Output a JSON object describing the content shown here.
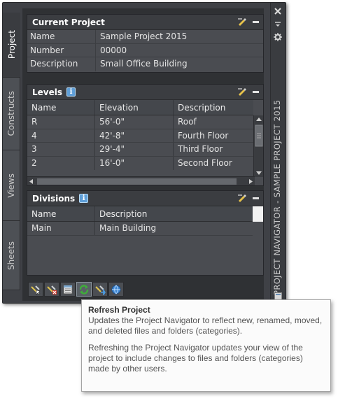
{
  "palette": {
    "title": "PROJECT NAVIGATOR - SAMPLE PROJECT 2015",
    "tabs": [
      {
        "label": "Project",
        "active": true
      },
      {
        "label": "Constructs",
        "active": false
      },
      {
        "label": "Views",
        "active": false
      },
      {
        "label": "Sheets",
        "active": false
      }
    ]
  },
  "current_project": {
    "title": "Current Project",
    "rows": [
      {
        "label": "Name",
        "value": "Sample Project 2015"
      },
      {
        "label": "Number",
        "value": "00000"
      },
      {
        "label": "Description",
        "value": "Small Office Building"
      }
    ]
  },
  "levels": {
    "title": "Levels",
    "columns": [
      "Name",
      "Elevation",
      "Description"
    ],
    "rows": [
      {
        "name": "R",
        "elevation": "56'-0\"",
        "description": "Roof"
      },
      {
        "name": "4",
        "elevation": "42'-8\"",
        "description": "Fourth Floor"
      },
      {
        "name": "3",
        "elevation": "29'-4\"",
        "description": "Third Floor"
      },
      {
        "name": "2",
        "elevation": "16'-0\"",
        "description": "Second Floor"
      }
    ]
  },
  "divisions": {
    "title": "Divisions",
    "columns": [
      "Name",
      "Description"
    ],
    "rows": [
      {
        "name": "Main",
        "description": "Main Building"
      }
    ]
  },
  "toolbar": {
    "icons": [
      "select-project-icon",
      "close-project-icon",
      "project-settings-icon",
      "refresh-project-icon",
      "repath-project-icon",
      "project-browser-icon"
    ]
  },
  "tooltip": {
    "title": "Refresh Project",
    "text1": "Updates the Project Navigator to reflect new, renamed, moved, and deleted files and folders (categories).",
    "text2": "Refreshing the Project Navigator updates your view of the project to include changes to files and folders (categories) made by other users."
  }
}
